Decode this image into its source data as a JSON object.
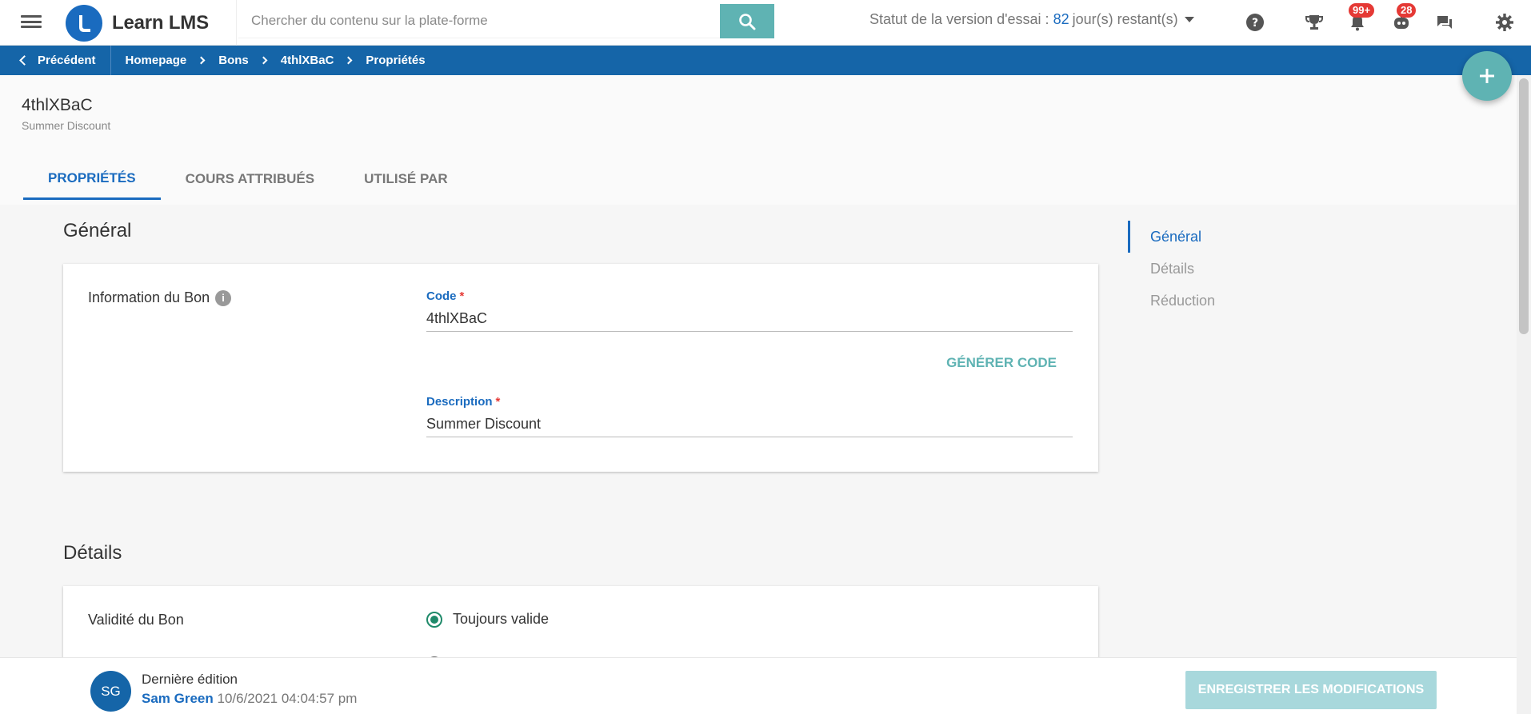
{
  "app": {
    "name": "Learn LMS",
    "search_placeholder": "Chercher du contenu sur la plate-forme",
    "trial_label": "Statut de la version d'essai :",
    "trial_days": "82",
    "trial_remaining": "jour(s) restant(s)",
    "notifications_badge": "99+",
    "messages_badge": "28"
  },
  "breadcrumb": {
    "back_label": "Précédent",
    "items": [
      "Homepage",
      "Bons",
      "4thlXBaC",
      "Propriétés"
    ]
  },
  "page": {
    "title": "4thlXBaC",
    "subtitle": "Summer Discount"
  },
  "tabs": [
    {
      "label": "Propriétés",
      "active": true
    },
    {
      "label": "Cours attribués",
      "active": false
    },
    {
      "label": "Utilisé par",
      "active": false
    }
  ],
  "general": {
    "section_title": "Général",
    "card_label": "Information du Bon",
    "code_label": "Code",
    "code_value": "4thlXBaC",
    "generate_label": "Générer code",
    "description_label": "Description",
    "description_value": "Summer Discount"
  },
  "details": {
    "section_title": "Détails",
    "card_label": "Validité du Bon",
    "option_always": "Toujours valide"
  },
  "sidenav": [
    {
      "label": "Général",
      "active": true
    },
    {
      "label": "Détails",
      "active": false
    },
    {
      "label": "Réduction",
      "active": false
    }
  ],
  "footer": {
    "avatar_initials": "SG",
    "last_edit_title": "Dernière édition",
    "user": "Sam Green",
    "timestamp": "10/6/2021 04:04:57 pm",
    "save_label": "Enregistrer les modifications"
  },
  "colors": {
    "primary": "#1565a8",
    "accent": "#5fb3b3",
    "badge": "#e53935"
  }
}
